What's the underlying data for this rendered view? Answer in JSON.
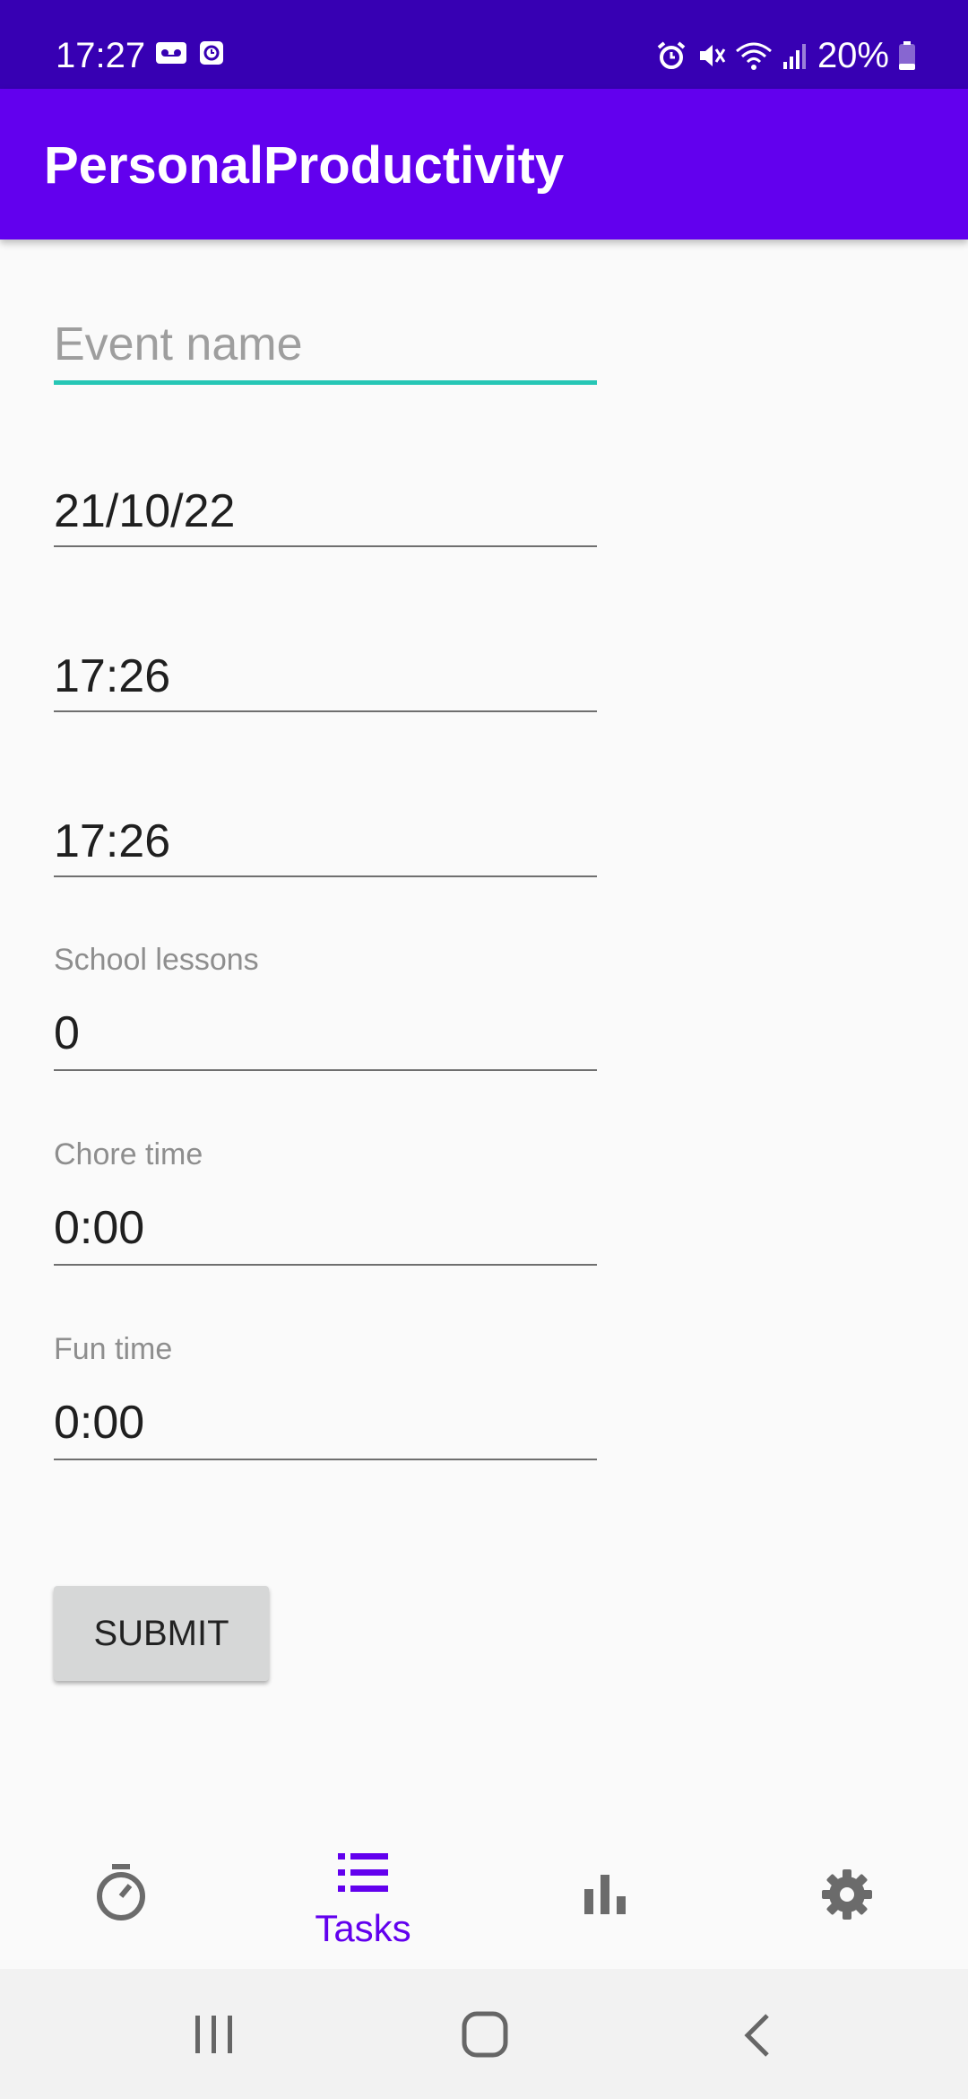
{
  "status_bar": {
    "time": "17:27",
    "battery": "20%",
    "left_icons": [
      "voicemail-icon",
      "clock-app-icon"
    ],
    "right_icons": [
      "alarm-icon",
      "mute-icon",
      "wifi-icon",
      "signal-icon",
      "battery-icon"
    ]
  },
  "app_bar": {
    "title": "PersonalProductivity"
  },
  "form": {
    "event_name": {
      "placeholder": "Event name",
      "value": ""
    },
    "date": {
      "value": "21/10/22"
    },
    "start_time": {
      "value": "17:26"
    },
    "end_time": {
      "value": "17:26"
    },
    "school_lessons": {
      "label": "School lessons",
      "value": "0"
    },
    "chore_time": {
      "label": "Chore time",
      "value": "0:00"
    },
    "fun_time": {
      "label": "Fun time",
      "value": "0:00"
    },
    "submit_label": "SUBMIT"
  },
  "bottom_nav": {
    "items": [
      {
        "icon": "timer-icon",
        "label": ""
      },
      {
        "icon": "list-icon",
        "label": "Tasks",
        "selected": true
      },
      {
        "icon": "bar-chart-icon",
        "label": ""
      },
      {
        "icon": "gear-icon",
        "label": ""
      }
    ]
  },
  "colors": {
    "status_bar": "#3700b3",
    "primary": "#6200ee",
    "focus_line": "#26c6b5",
    "icon_gray": "#6b6b6b"
  }
}
